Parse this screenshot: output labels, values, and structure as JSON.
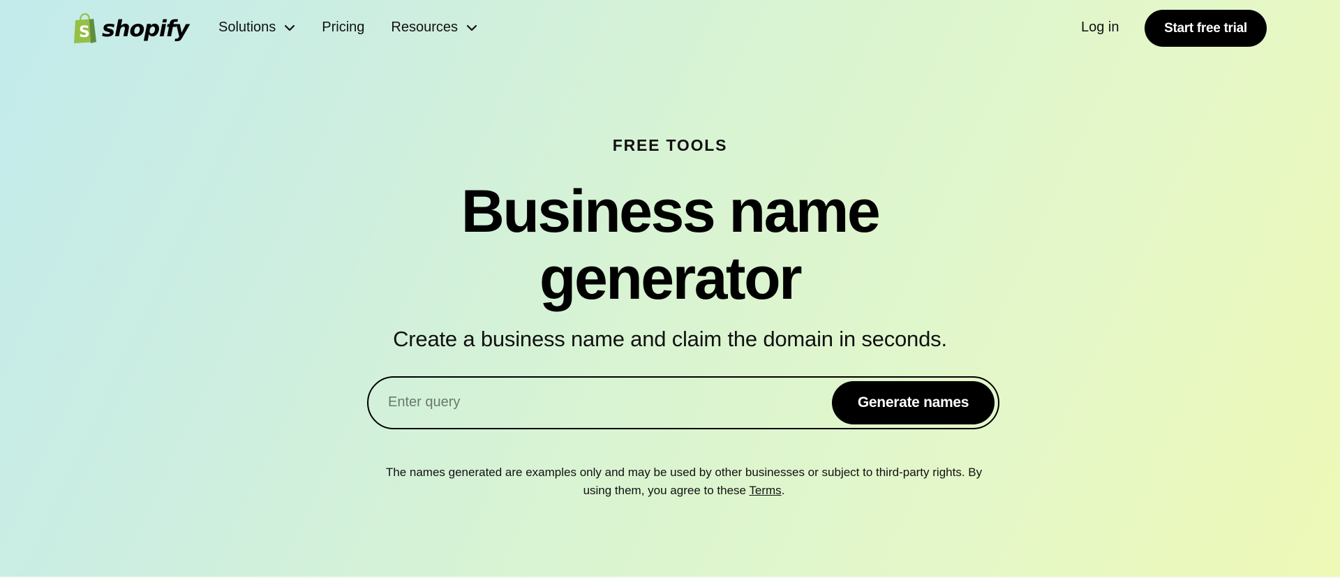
{
  "header": {
    "brand": {
      "name": "shopify",
      "icon": "shopping-bag-logo-icon",
      "color": "#95bf47"
    },
    "nav": [
      {
        "label": "Solutions",
        "has_dropdown": true,
        "icon": "chevron-down-icon"
      },
      {
        "label": "Pricing",
        "has_dropdown": false
      },
      {
        "label": "Resources",
        "has_dropdown": true,
        "icon": "chevron-down-icon"
      }
    ],
    "login_label": "Log in",
    "cta_label": "Start free trial"
  },
  "hero": {
    "eyebrow": "FREE TOOLS",
    "title_line1": "Business name",
    "title_line2": "generator",
    "subtitle": "Create a business name and claim the domain in seconds.",
    "search": {
      "placeholder": "Enter query",
      "value": "",
      "button_label": "Generate names"
    },
    "disclaimer": {
      "text_before": "The names generated are examples only and may be used by other businesses or subject to third-party rights. By using them, you agree to these ",
      "link_label": "Terms",
      "text_after": "."
    }
  },
  "colors": {
    "primary_button": "#000000",
    "primary_button_text": "#ffffff",
    "brand_green": "#95bf47",
    "background_gradient": [
      "#c3ebec",
      "#d9f4d2",
      "#eef9b6"
    ]
  }
}
